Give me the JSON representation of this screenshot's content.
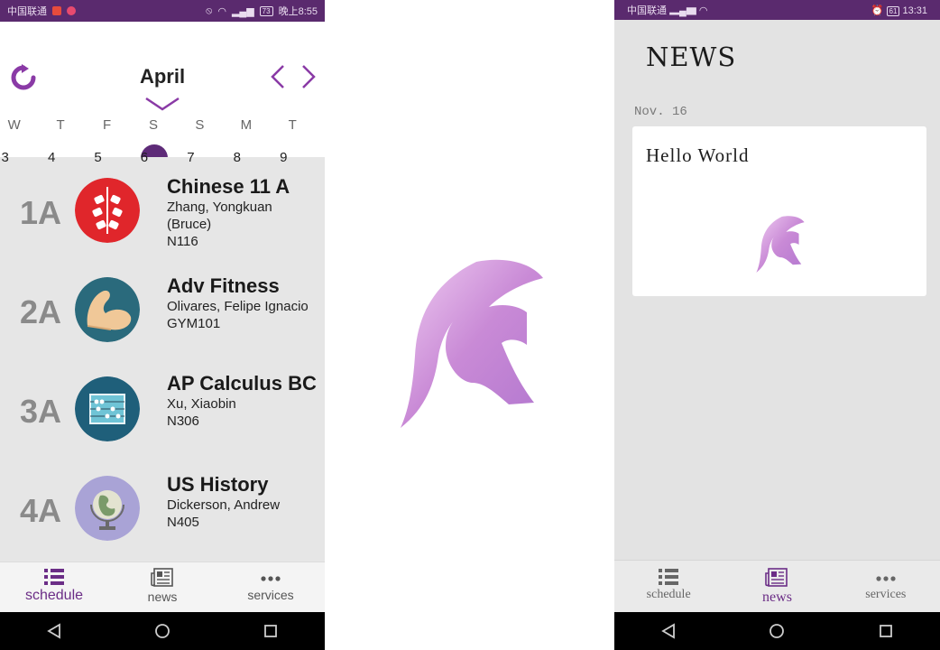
{
  "schedule_screen": {
    "status_bar": {
      "carrier": "中国联通",
      "time": "晚上8:55",
      "battery": "73"
    },
    "calendar": {
      "month": "April",
      "weekdays": [
        "W",
        "T",
        "F",
        "S",
        "S",
        "M",
        "T"
      ],
      "dates": [
        "3",
        "4",
        "5",
        "6",
        "7",
        "8",
        "9"
      ],
      "selected_date": "6"
    },
    "classes": [
      {
        "period": "1A",
        "name": "Chinese 11 A",
        "teacher": "Zhang, Yongkuan (Bruce)",
        "room": "N116",
        "icon": "firecracker-icon",
        "icon_bg": "#e0262b"
      },
      {
        "period": "2A",
        "name": "Adv Fitness",
        "teacher": "Olivares, Felipe Ignacio",
        "room": "GYM101",
        "icon": "flexed-arm-icon",
        "icon_bg": "#2a6a7c"
      },
      {
        "period": "3A",
        "name": "AP Calculus BC",
        "teacher": "Xu, Xiaobin",
        "room": "N306",
        "icon": "abacus-icon",
        "icon_bg": "#1f5f7a"
      },
      {
        "period": "4A",
        "name": "US History",
        "teacher": "Dickerson, Andrew",
        "room": "N405",
        "icon": "globe-icon",
        "icon_bg": "#a9a3d6"
      }
    ],
    "tabs": [
      {
        "label": "schedule",
        "icon": "list-icon",
        "active": true
      },
      {
        "label": "news",
        "icon": "newspaper-icon",
        "active": false
      },
      {
        "label": "services",
        "icon": "more-icon",
        "active": false
      }
    ],
    "accent_color": "#5e2b78"
  },
  "splash_screen": {
    "logo": "spartan-helmet-logo"
  },
  "news_screen": {
    "status_bar": {
      "time": "13:31",
      "battery": "61"
    },
    "title": "NEWS",
    "date": "Nov. 16",
    "card": {
      "title": "Hello World",
      "image": "spartan-helmet-logo"
    },
    "tabs": [
      {
        "label": "schedule",
        "icon": "list-icon",
        "active": false
      },
      {
        "label": "news",
        "icon": "newspaper-icon",
        "active": true
      },
      {
        "label": "services",
        "icon": "more-icon",
        "active": false
      }
    ]
  }
}
